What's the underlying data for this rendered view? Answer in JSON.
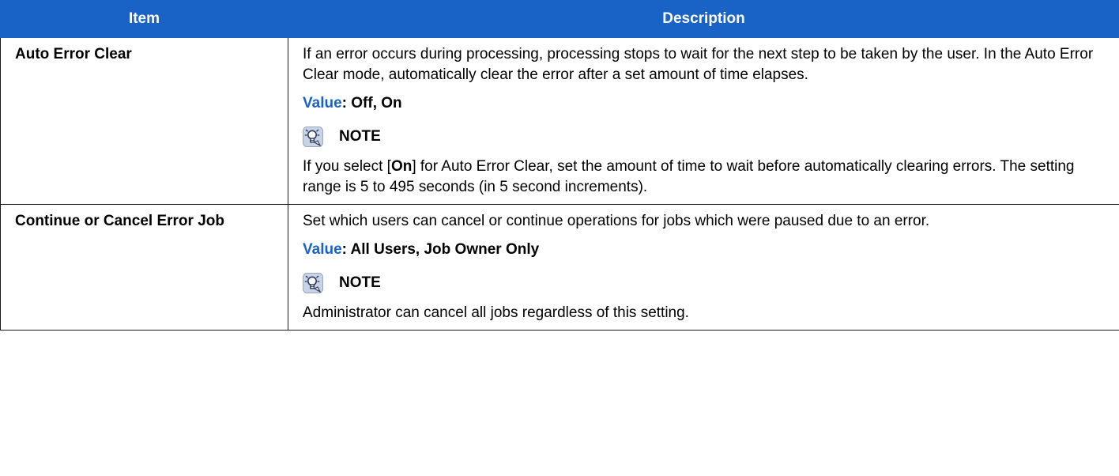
{
  "table": {
    "headers": {
      "item": "Item",
      "description": "Description"
    },
    "rows": [
      {
        "item": "Auto Error Clear",
        "paragraph": "If an error occurs during processing, processing stops to wait for the next step to be taken by the user. In the Auto Error Clear mode, automatically clear the error after a set amount of time elapses.",
        "value_label": "Value",
        "value_text": ": Off, On",
        "note_title": "NOTE",
        "note_before": "If you select [",
        "note_bold": "On",
        "note_after": "] for Auto Error Clear, set the amount of time to wait before automatically clearing errors. The setting range is 5 to 495 seconds (in 5 second increments)."
      },
      {
        "item": "Continue or Cancel Error Job",
        "paragraph": "Set which users can cancel or continue operations for jobs which were paused due to an error.",
        "value_label": "Value",
        "value_text": ": All Users, Job Owner Only",
        "note_title": "NOTE",
        "note_text": "Administrator can cancel all jobs regardless of this setting."
      }
    ]
  },
  "colors": {
    "header_bg": "#1a63c6",
    "value_label": "#1a63c6"
  },
  "icons": {
    "note": "lightbulb-note-icon"
  }
}
